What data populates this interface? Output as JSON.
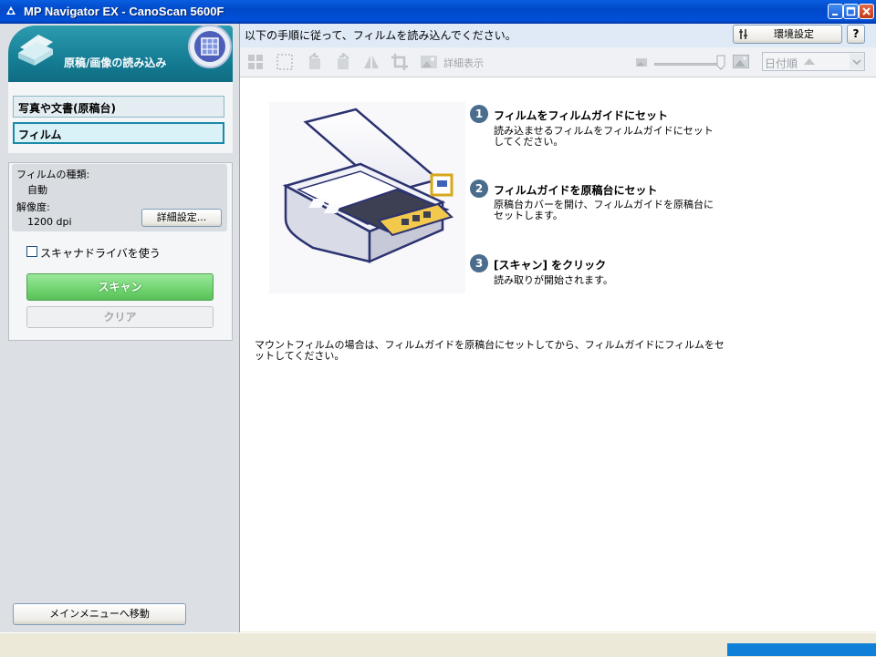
{
  "window": {
    "title": "MP Navigator EX - CanoScan 5600F"
  },
  "mode": {
    "header_title": "原稿/画像の読み込み",
    "items": [
      "写真や文書(原稿台)",
      "フィルム"
    ]
  },
  "settings": {
    "film_type_label": "フィルムの種類:",
    "film_type_value": "自動",
    "resolution_label": "解像度:",
    "resolution_value": "1200 dpi",
    "detail_button": "詳細設定...",
    "driver_checkbox_label": "スキャナドライバを使う",
    "scan_button": "スキャン",
    "clear_button": "クリア"
  },
  "main_menu_button": "メインメニューへ移動",
  "instruction": "以下の手順に従って、フィルムを読み込んでください。",
  "env_button": "環境設定",
  "help_button": "?",
  "toolbar": {
    "detail_label": "詳細表示",
    "sort_value": "日付順"
  },
  "steps": [
    {
      "num": "1",
      "title": "フィルムをフィルムガイドにセット",
      "desc": "読み込ませるフィルムをフィルムガイドにセットしてください。"
    },
    {
      "num": "2",
      "title": "フィルムガイドを原稿台にセット",
      "desc": "原稿台カバーを開け、フィルムガイドを原稿台にセットします。"
    },
    {
      "num": "3",
      "title": "[スキャン] をクリック",
      "desc": "読み取りが開始されます。"
    }
  ],
  "mount_note": "マウントフィルムの場合は、フィルムガイドを原稿台にセットしてから、フィルムガイドにフィルムをセットしてください。",
  "colors": {
    "accent": "#157e95",
    "scan_green": "#6fd36f",
    "titlebar": "#0050d8"
  },
  "icons": [
    "app-icon",
    "scanner-icon",
    "grid-view-icon",
    "thumbnail-icon",
    "rotate-left-icon",
    "rotate-right-icon",
    "mirror-icon",
    "crop-icon",
    "detail-view-icon",
    "zoom-small-icon",
    "zoom-large-icon",
    "env-settings-icon",
    "help-icon"
  ]
}
